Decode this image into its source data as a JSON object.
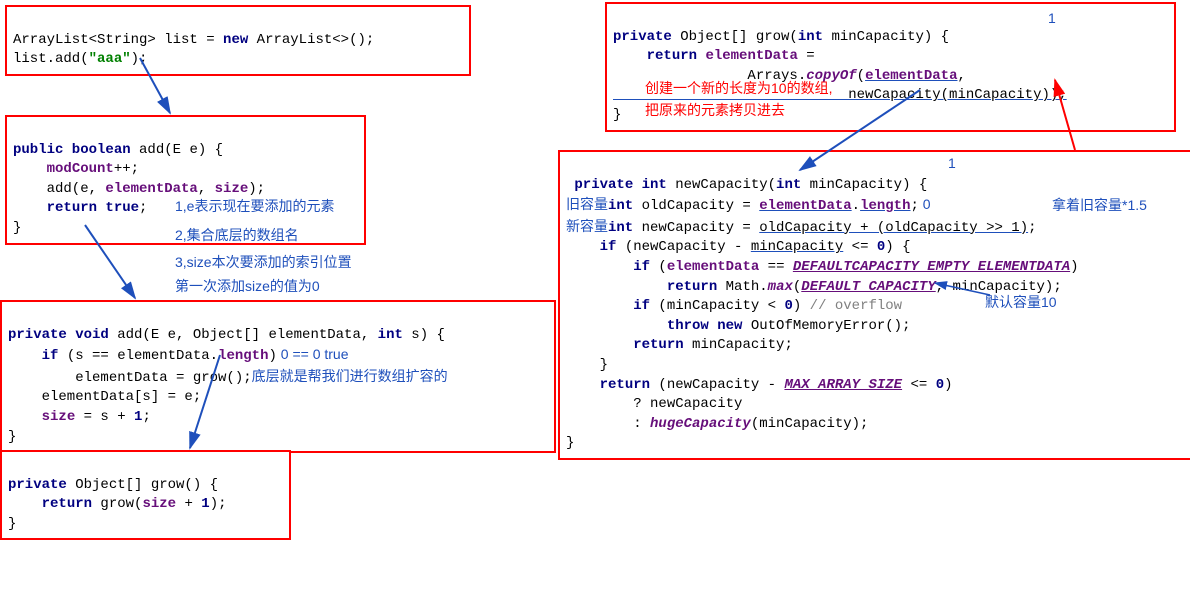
{
  "box1": {
    "l1a": "ArrayList<String> list = ",
    "l1b": "new",
    "l1c": " ArrayList<>();",
    "l2a": "list.add(",
    "l2b": "\"aaa\"",
    "l2c": ");"
  },
  "box2": {
    "l1a": "public boolean ",
    "l1b": "add(E e) {",
    "l2a": "    ",
    "l2b": "modCount",
    "l2c": "++;",
    "l3a": "    add(e, ",
    "l3b": "elementData",
    "l3c": ", ",
    "l3d": "size",
    "l3e": ");",
    "l4a": "    ",
    "l4b": "return true",
    "l4c": ";",
    "l5": "}"
  },
  "anno2": {
    "a1": "1,e表示现在要添加的元素",
    "a2": "2,集合底层的数组名",
    "a3": "3,size本次要添加的索引位置",
    "a4": "第一次添加size的值为0"
  },
  "box3": {
    "l1a": "private void ",
    "l1b": "add(E e, Object[] elementData, ",
    "l1c": "int",
    "l1d": " s) {",
    "l2a": "    ",
    "l2b": "if",
    "l2c": " (s == elementData.",
    "l2d": "length",
    "l2e": ")",
    "l2anno": " 0 == 0 true",
    "l3a": "        elementData = grow();",
    "l3anno": "底层就是帮我们进行数组扩容的",
    "l4a": "    elementData[s] = e;",
    "l5a": "    ",
    "l5b": "size",
    "l5c": " = s + ",
    "l5d": "1",
    "l5e": ";",
    "l6": "}"
  },
  "box4": {
    "l1a": "private",
    "l1b": " Object[] grow() {",
    "l2a": "    ",
    "l2b": "return",
    "l2c": " grow(",
    "l2d": "size",
    "l2e": " + ",
    "l2f": "1",
    "l2g": ");",
    "l3": "}"
  },
  "box5": {
    "l1a": "private",
    "l1b": " Object[] grow(",
    "l1c": "int",
    "l1d": " minCapacity) {",
    "l1anno": "1",
    "l2a": "    ",
    "l2b": "return",
    "l2c": " ",
    "l2d": "elementData",
    "l2e": " =",
    "l3a": "                Arrays.",
    "l3b": "copyOf",
    "l3c": "(",
    "l3d": "elementData",
    "l3e": ",",
    "l4a": "                            newCapacity(minCapacity));",
    "l5": "}",
    "red1": "创建一个新的长度为10的数组,",
    "red2": "把原来的元素拷贝进去"
  },
  "box6": {
    "l0anno": "1",
    "l1a": " ",
    "l1b": "private int",
    "l1c": " newCapacity(",
    "l1d": "int",
    "l1e": " minCapacity) {",
    "l2pre": "旧容量",
    "l2a": "int",
    "l2b": " oldCapacity = ",
    "l2c": "elementData",
    "l2d": ".",
    "l2e": "length",
    "l2f": ";",
    "l2anno": " 0",
    "l2anno2": "拿着旧容量*1.5",
    "l3pre": "新容量",
    "l3a": "int",
    "l3b": " newCapacity = ",
    "l3c": "oldCapacity + (oldCapacity >> 1)",
    "l3d": ";",
    "l4a": "    ",
    "l4b": "if",
    "l4c": " (newCapacity - ",
    "l4d": "minCapacity",
    "l4e": " <= ",
    "l4f": "0",
    "l4g": ") {",
    "l5a": "        ",
    "l5b": "if",
    "l5c": " (",
    "l5d": "elementData",
    "l5e": " == ",
    "l5f": "DEFAULTCAPACITY_EMPTY_ELEMENTDATA",
    "l5g": ")",
    "l6a": "            ",
    "l6b": "return",
    "l6c": " Math.",
    "l6d": "max",
    "l6e": "(",
    "l6f": "DEFAULT_CAPACITY",
    "l6g": ", minCapacity);",
    "l7a": "        ",
    "l7b": "if",
    "l7c": " (minCapacity < ",
    "l7d": "0",
    "l7e": ") ",
    "l7f": "// overflow",
    "l7anno": "默认容量10",
    "l8a": "            ",
    "l8b": "throw new",
    "l8c": " OutOfMemoryError();",
    "l9a": "        ",
    "l9b": "return",
    "l9c": " minCapacity;",
    "l10": "    }",
    "l11a": "    ",
    "l11b": "return",
    "l11c": " (newCapacity - ",
    "l11d": "MAX_ARRAY_SIZE",
    "l11e": " <= ",
    "l11f": "0",
    "l11g": ")",
    "l12a": "        ? newCapacity",
    "l13a": "        : ",
    "l13b": "hugeCapacity",
    "l13c": "(minCapacity);",
    "l14": "}"
  }
}
